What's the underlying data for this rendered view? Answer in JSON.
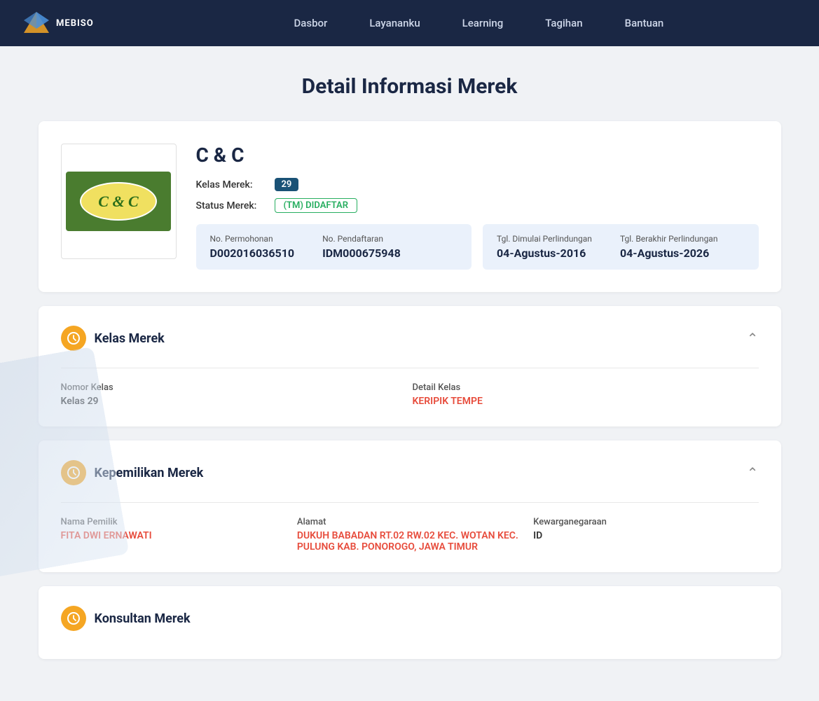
{
  "brand": {
    "text": "MEBISO"
  },
  "nav": {
    "items": [
      {
        "label": "Dasbor"
      },
      {
        "label": "Layananku"
      },
      {
        "label": "Learning"
      },
      {
        "label": "Tagihan"
      },
      {
        "label": "Bantuan"
      }
    ]
  },
  "page": {
    "title": "Detail Informasi Merek"
  },
  "merek": {
    "name": "C & C",
    "kelas_label": "Kelas Merek:",
    "kelas_value": "29",
    "status_label": "Status Merek:",
    "status_value": "(TM) DIDAFTAR",
    "no_permohonan_label": "No. Permohonan",
    "no_permohonan_value": "D002016036510",
    "no_pendaftaran_label": "No. Pendaftaran",
    "no_pendaftaran_value": "IDM000675948",
    "tgl_mulai_label": "Tgl. Dimulai Perlindungan",
    "tgl_mulai_value": "04-Agustus-2016",
    "tgl_berakhir_label": "Tgl. Berakhir Perlindungan",
    "tgl_berakhir_value": "04-Agustus-2026"
  },
  "kelas_merek": {
    "section_title": "Kelas Merek",
    "nomor_kelas_label": "Nomor Kelas",
    "nomor_kelas_value": "Kelas 29",
    "detail_kelas_label": "Detail Kelas",
    "detail_kelas_value": "KERIPIK TEMPE"
  },
  "kepemilikan": {
    "section_title": "Kepemilikan Merek",
    "nama_label": "Nama Pemilik",
    "nama_value": "FITA DWI ERNAWATI",
    "alamat_label": "Alamat",
    "alamat_value": "DUKUH BABADAN RT.02 RW.02 KEC. WOTAN KEC. PULUNG KAB. PONOROGO, JAWA TIMUR",
    "kewarganegaraan_label": "Kewarganegaraan",
    "kewarganegaraan_value": "ID"
  },
  "konsultan": {
    "section_title": "Konsultan Merek"
  }
}
